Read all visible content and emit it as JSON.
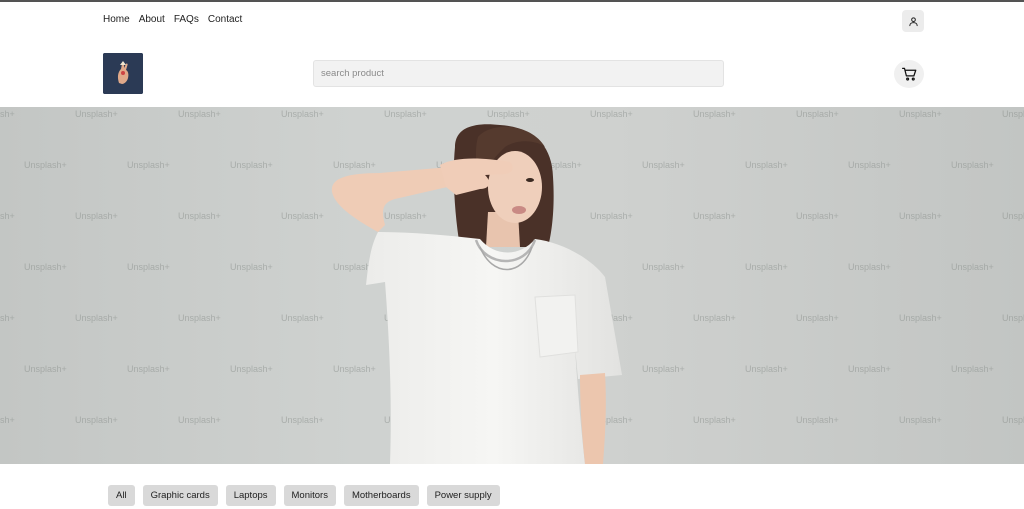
{
  "nav": {
    "links": [
      "Home",
      "About",
      "FAQs",
      "Contact"
    ],
    "account_icon": "user-icon"
  },
  "header": {
    "logo_icon": "hand-logo",
    "search": {
      "placeholder": "search product",
      "value": ""
    },
    "cart_icon": "cart-icon"
  },
  "hero": {
    "watermark": "Unsplash+"
  },
  "categories": [
    "All",
    "Graphic cards",
    "Laptops",
    "Monitors",
    "Motherboards",
    "Power supply"
  ],
  "colors": {
    "chip_bg": "#d9d9d9",
    "hero_bg": "#cfd2d0",
    "logo_bg": "#2b3a55"
  }
}
